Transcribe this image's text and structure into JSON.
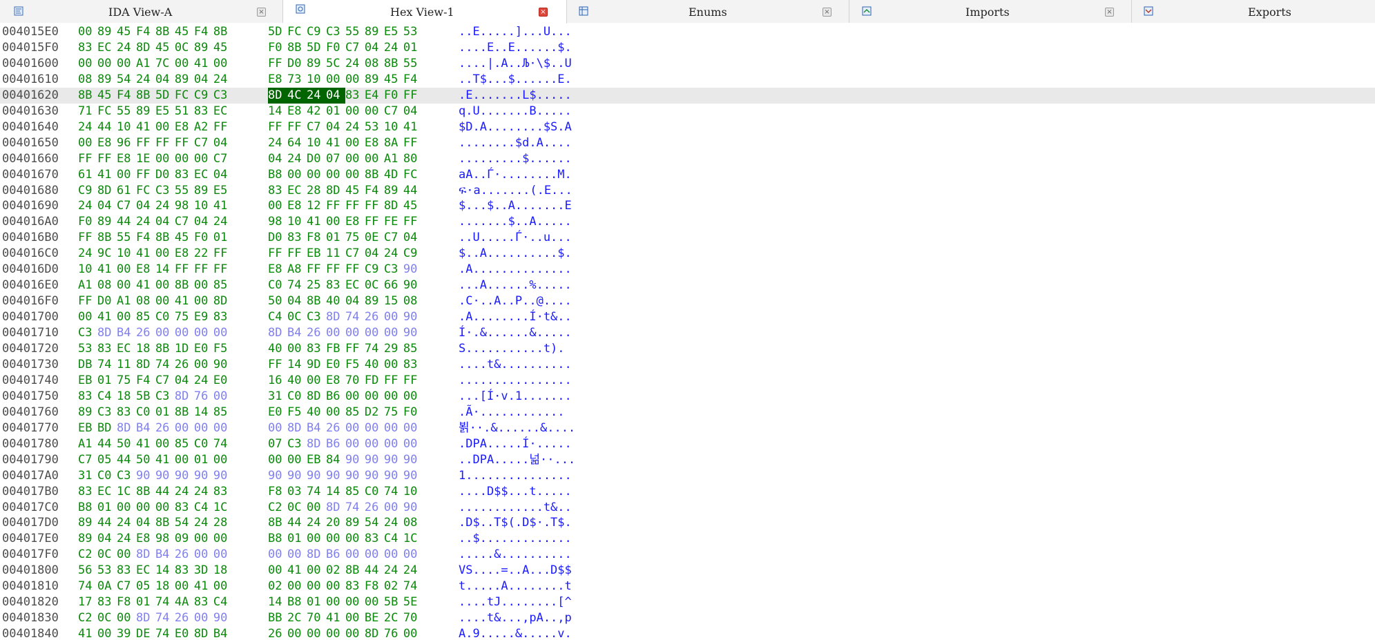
{
  "tabs": [
    {
      "label": "IDA View-A",
      "icon": "ida-view-icon",
      "close": "×",
      "active": false
    },
    {
      "label": "Hex View-1",
      "icon": "hex-view-icon",
      "close": "×",
      "active": true
    },
    {
      "label": "Enums",
      "icon": "enums-icon",
      "close": "×",
      "active": false
    },
    {
      "label": "Imports",
      "icon": "imports-icon",
      "close": "×",
      "active": false
    },
    {
      "label": "Exports",
      "icon": "exports-icon",
      "close": "",
      "active": false
    }
  ],
  "hex_view": {
    "current_row": 4,
    "selected": {
      "row": 4,
      "from": 8,
      "to": 11
    },
    "colors": {
      "address": "#4d4d4d",
      "byte": "#0b8a0b",
      "padding_byte": "#8080f0",
      "ascii": "#1a1aff",
      "selection_bg": "#006400",
      "current_line_bg": "#e9e9e9"
    },
    "rows": [
      {
        "address": "004015E0",
        "bytes": [
          "00",
          "89",
          "45",
          "F4",
          "8B",
          "45",
          "F4",
          "8B",
          "5D",
          "FC",
          "C9",
          "C3",
          "55",
          "89",
          "E5",
          "53"
        ],
        "ascii": "..E.....]...U...",
        "pad": []
      },
      {
        "address": "004015F0",
        "bytes": [
          "83",
          "EC",
          "24",
          "8D",
          "45",
          "0C",
          "89",
          "45",
          "F0",
          "8B",
          "5D",
          "F0",
          "C7",
          "04",
          "24",
          "01"
        ],
        "ascii": "....E..E......$.",
        "pad": []
      },
      {
        "address": "00401600",
        "bytes": [
          "00",
          "00",
          "00",
          "A1",
          "7C",
          "00",
          "41",
          "00",
          "FF",
          "D0",
          "89",
          "5C",
          "24",
          "08",
          "8B",
          "55"
        ],
        "ascii": "....|.A..Љ·\\$..U",
        "pad": []
      },
      {
        "address": "00401610",
        "bytes": [
          "08",
          "89",
          "54",
          "24",
          "04",
          "89",
          "04",
          "24",
          "E8",
          "73",
          "10",
          "00",
          "00",
          "89",
          "45",
          "F4"
        ],
        "ascii": "..T$...$......E.",
        "pad": []
      },
      {
        "address": "00401620",
        "bytes": [
          "8B",
          "45",
          "F4",
          "8B",
          "5D",
          "FC",
          "C9",
          "C3",
          "8D",
          "4C",
          "24",
          "04",
          "83",
          "E4",
          "F0",
          "FF"
        ],
        "ascii": ".E.......L$.....",
        "pad": []
      },
      {
        "address": "00401630",
        "bytes": [
          "71",
          "FC",
          "55",
          "89",
          "E5",
          "51",
          "83",
          "EC",
          "14",
          "E8",
          "42",
          "01",
          "00",
          "00",
          "C7",
          "04"
        ],
        "ascii": "q.U.......B.....",
        "pad": []
      },
      {
        "address": "00401640",
        "bytes": [
          "24",
          "44",
          "10",
          "41",
          "00",
          "E8",
          "A2",
          "FF",
          "FF",
          "FF",
          "C7",
          "04",
          "24",
          "53",
          "10",
          "41"
        ],
        "ascii": "$D.A........$S.A",
        "pad": []
      },
      {
        "address": "00401650",
        "bytes": [
          "00",
          "E8",
          "96",
          "FF",
          "FF",
          "FF",
          "C7",
          "04",
          "24",
          "64",
          "10",
          "41",
          "00",
          "E8",
          "8A",
          "FF"
        ],
        "ascii": "........$d.A....",
        "pad": []
      },
      {
        "address": "00401660",
        "bytes": [
          "FF",
          "FF",
          "E8",
          "1E",
          "00",
          "00",
          "00",
          "C7",
          "04",
          "24",
          "D0",
          "07",
          "00",
          "00",
          "A1",
          "80"
        ],
        "ascii": ".........$......",
        "pad": []
      },
      {
        "address": "00401670",
        "bytes": [
          "61",
          "41",
          "00",
          "FF",
          "D0",
          "83",
          "EC",
          "04",
          "B8",
          "00",
          "00",
          "00",
          "00",
          "8B",
          "4D",
          "FC"
        ],
        "ascii": "aA..Ѓ·........M.",
        "pad": []
      },
      {
        "address": "00401680",
        "bytes": [
          "C9",
          "8D",
          "61",
          "FC",
          "C3",
          "55",
          "89",
          "E5",
          "83",
          "EC",
          "28",
          "8D",
          "45",
          "F4",
          "89",
          "44"
        ],
        "ascii": "ፍ·a.......(.E...",
        "pad": []
      },
      {
        "address": "00401690",
        "bytes": [
          "24",
          "04",
          "C7",
          "04",
          "24",
          "98",
          "10",
          "41",
          "00",
          "E8",
          "12",
          "FF",
          "FF",
          "FF",
          "8D",
          "45"
        ],
        "ascii": "$...$..A.......E",
        "pad": []
      },
      {
        "address": "004016A0",
        "bytes": [
          "F0",
          "89",
          "44",
          "24",
          "04",
          "C7",
          "04",
          "24",
          "98",
          "10",
          "41",
          "00",
          "E8",
          "FF",
          "FE",
          "FF"
        ],
        "ascii": ".......$..A.....",
        "pad": []
      },
      {
        "address": "004016B0",
        "bytes": [
          "FF",
          "8B",
          "55",
          "F4",
          "8B",
          "45",
          "F0",
          "01",
          "D0",
          "83",
          "F8",
          "01",
          "75",
          "0E",
          "C7",
          "04"
        ],
        "ascii": "..U.....Ѓ·..u...",
        "pad": []
      },
      {
        "address": "004016C0",
        "bytes": [
          "24",
          "9C",
          "10",
          "41",
          "00",
          "E8",
          "22",
          "FF",
          "FF",
          "FF",
          "EB",
          "11",
          "C7",
          "04",
          "24",
          "C9"
        ],
        "ascii": "$..A..........$.",
        "pad": []
      },
      {
        "address": "004016D0",
        "bytes": [
          "10",
          "41",
          "00",
          "E8",
          "14",
          "FF",
          "FF",
          "FF",
          "E8",
          "A8",
          "FF",
          "FF",
          "FF",
          "C9",
          "C3",
          "90"
        ],
        "ascii": ".A..............",
        "pad": [
          15
        ]
      },
      {
        "address": "004016E0",
        "bytes": [
          "A1",
          "08",
          "00",
          "41",
          "00",
          "8B",
          "00",
          "85",
          "C0",
          "74",
          "25",
          "83",
          "EC",
          "0C",
          "66",
          "90"
        ],
        "ascii": "...A......%.....",
        "pad": []
      },
      {
        "address": "004016F0",
        "bytes": [
          "FF",
          "D0",
          "A1",
          "08",
          "00",
          "41",
          "00",
          "8D",
          "50",
          "04",
          "8B",
          "40",
          "04",
          "89",
          "15",
          "08"
        ],
        "ascii": ".C·..A..P..@....",
        "pad": []
      },
      {
        "address": "00401700",
        "bytes": [
          "00",
          "41",
          "00",
          "85",
          "C0",
          "75",
          "E9",
          "83",
          "C4",
          "0C",
          "C3",
          "8D",
          "74",
          "26",
          "00",
          "90"
        ],
        "ascii": ".A........Í·t&..",
        "pad": [
          11,
          12,
          13,
          14,
          15
        ]
      },
      {
        "address": "00401710",
        "bytes": [
          "C3",
          "8D",
          "B4",
          "26",
          "00",
          "00",
          "00",
          "00",
          "8D",
          "B4",
          "26",
          "00",
          "00",
          "00",
          "00",
          "90"
        ],
        "ascii": "Í·.&......&.....",
        "pad": [
          1,
          2,
          3,
          4,
          5,
          6,
          7,
          8,
          9,
          10,
          11,
          12,
          13,
          14,
          15
        ]
      },
      {
        "address": "00401720",
        "bytes": [
          "53",
          "83",
          "EC",
          "18",
          "8B",
          "1D",
          "E0",
          "F5",
          "40",
          "00",
          "83",
          "FB",
          "FF",
          "74",
          "29",
          "85"
        ],
        "ascii": "S...........t).",
        "pad": []
      },
      {
        "address": "00401730",
        "bytes": [
          "DB",
          "74",
          "11",
          "8D",
          "74",
          "26",
          "00",
          "90",
          "FF",
          "14",
          "9D",
          "E0",
          "F5",
          "40",
          "00",
          "83"
        ],
        "ascii": "....t&..........",
        "pad": []
      },
      {
        "address": "00401740",
        "bytes": [
          "EB",
          "01",
          "75",
          "F4",
          "C7",
          "04",
          "24",
          "E0",
          "16",
          "40",
          "00",
          "E8",
          "70",
          "FD",
          "FF",
          "FF"
        ],
        "ascii": "................",
        "pad": []
      },
      {
        "address": "00401750",
        "bytes": [
          "83",
          "C4",
          "18",
          "5B",
          "C3",
          "8D",
          "76",
          "00",
          "31",
          "C0",
          "8D",
          "B6",
          "00",
          "00",
          "00",
          "00"
        ],
        "ascii": "...[Í·v.1.......",
        "pad": [
          5,
          6,
          7
        ]
      },
      {
        "address": "00401760",
        "bytes": [
          "89",
          "C3",
          "83",
          "C0",
          "01",
          "8B",
          "14",
          "85",
          "E0",
          "F5",
          "40",
          "00",
          "85",
          "D2",
          "75",
          "F0"
        ],
        "ascii": ".Ã·............",
        "pad": []
      },
      {
        "address": "00401770",
        "bytes": [
          "EB",
          "BD",
          "8D",
          "B4",
          "26",
          "00",
          "00",
          "00",
          "00",
          "8D",
          "B4",
          "26",
          "00",
          "00",
          "00",
          "00"
        ],
        "ascii": "뵑··.&......&....",
        "pad": [
          2,
          3,
          4,
          5,
          6,
          7,
          8,
          9,
          10,
          11,
          12,
          13,
          14,
          15
        ]
      },
      {
        "address": "00401780",
        "bytes": [
          "A1",
          "44",
          "50",
          "41",
          "00",
          "85",
          "C0",
          "74",
          "07",
          "C3",
          "8D",
          "B6",
          "00",
          "00",
          "00",
          "00"
        ],
        "ascii": ".DPA.....Í·.....",
        "pad": [
          10,
          11,
          12,
          13,
          14,
          15
        ]
      },
      {
        "address": "00401790",
        "bytes": [
          "C7",
          "05",
          "44",
          "50",
          "41",
          "00",
          "01",
          "00",
          "00",
          "00",
          "EB",
          "84",
          "90",
          "90",
          "90",
          "90"
        ],
        "ascii": "..DPA.....넒··...",
        "pad": [
          12,
          13,
          14,
          15
        ]
      },
      {
        "address": "004017A0",
        "bytes": [
          "31",
          "C0",
          "C3",
          "90",
          "90",
          "90",
          "90",
          "90",
          "90",
          "90",
          "90",
          "90",
          "90",
          "90",
          "90",
          "90"
        ],
        "ascii": "1...............",
        "pad": [
          3,
          4,
          5,
          6,
          7,
          8,
          9,
          10,
          11,
          12,
          13,
          14,
          15
        ]
      },
      {
        "address": "004017B0",
        "bytes": [
          "83",
          "EC",
          "1C",
          "8B",
          "44",
          "24",
          "24",
          "83",
          "F8",
          "03",
          "74",
          "14",
          "85",
          "C0",
          "74",
          "10"
        ],
        "ascii": "....D$$...t.....",
        "pad": []
      },
      {
        "address": "004017C0",
        "bytes": [
          "B8",
          "01",
          "00",
          "00",
          "00",
          "83",
          "C4",
          "1C",
          "C2",
          "0C",
          "00",
          "8D",
          "74",
          "26",
          "00",
          "90"
        ],
        "ascii": "............t&..",
        "pad": [
          11,
          12,
          13,
          14,
          15
        ]
      },
      {
        "address": "004017D0",
        "bytes": [
          "89",
          "44",
          "24",
          "04",
          "8B",
          "54",
          "24",
          "28",
          "8B",
          "44",
          "24",
          "20",
          "89",
          "54",
          "24",
          "08"
        ],
        "ascii": ".D$..T$(.D$·.T$.",
        "pad": []
      },
      {
        "address": "004017E0",
        "bytes": [
          "89",
          "04",
          "24",
          "E8",
          "98",
          "09",
          "00",
          "00",
          "B8",
          "01",
          "00",
          "00",
          "00",
          "83",
          "C4",
          "1C"
        ],
        "ascii": "..$.............",
        "pad": []
      },
      {
        "address": "004017F0",
        "bytes": [
          "C2",
          "0C",
          "00",
          "8D",
          "B4",
          "26",
          "00",
          "00",
          "00",
          "00",
          "8D",
          "B6",
          "00",
          "00",
          "00",
          "00"
        ],
        "ascii": ".....&..........",
        "pad": [
          3,
          4,
          5,
          6,
          7,
          8,
          9,
          10,
          11,
          12,
          13,
          14,
          15
        ]
      },
      {
        "address": "00401800",
        "bytes": [
          "56",
          "53",
          "83",
          "EC",
          "14",
          "83",
          "3D",
          "18",
          "00",
          "41",
          "00",
          "02",
          "8B",
          "44",
          "24",
          "24"
        ],
        "ascii": "VS....=..A...D$$",
        "pad": []
      },
      {
        "address": "00401810",
        "bytes": [
          "74",
          "0A",
          "C7",
          "05",
          "18",
          "00",
          "41",
          "00",
          "02",
          "00",
          "00",
          "00",
          "83",
          "F8",
          "02",
          "74"
        ],
        "ascii": "t.....A........t",
        "pad": []
      },
      {
        "address": "00401820",
        "bytes": [
          "17",
          "83",
          "F8",
          "01",
          "74",
          "4A",
          "83",
          "C4",
          "14",
          "B8",
          "01",
          "00",
          "00",
          "00",
          "5B",
          "5E"
        ],
        "ascii": "....tJ........[^",
        "pad": []
      },
      {
        "address": "00401830",
        "bytes": [
          "C2",
          "0C",
          "00",
          "8D",
          "74",
          "26",
          "00",
          "90",
          "BB",
          "2C",
          "70",
          "41",
          "00",
          "BE",
          "2C",
          "70"
        ],
        "ascii": "....t&...,pA..,p",
        "pad": [
          3,
          4,
          5,
          6,
          7
        ]
      },
      {
        "address": "00401840",
        "bytes": [
          "41",
          "00",
          "39",
          "DE",
          "74",
          "E0",
          "8D",
          "B4",
          "26",
          "00",
          "00",
          "00",
          "00",
          "8D",
          "76",
          "00"
        ],
        "ascii": "A.9.....&.....v.",
        "pad": []
      }
    ]
  }
}
